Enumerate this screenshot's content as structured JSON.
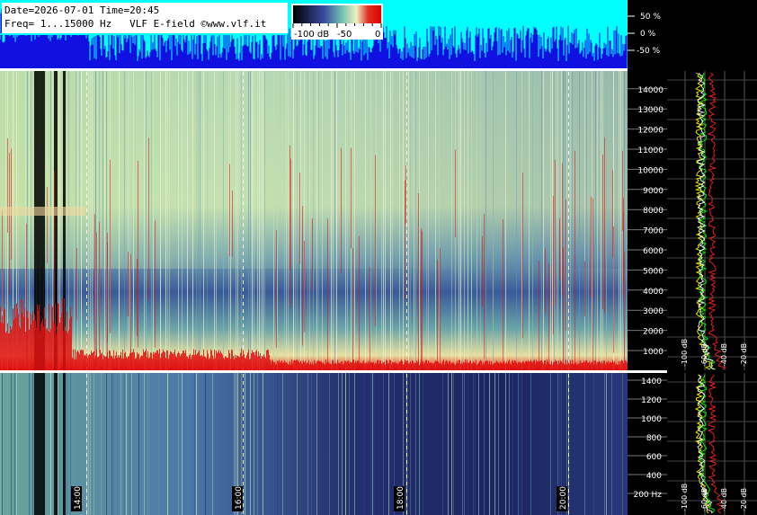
{
  "header": {
    "line1": "Date=2026-07-01 Time=20:45",
    "line2": "Freq= 1...15000 Hz   VLF E-field ©www.vlf.it"
  },
  "colorbar": {
    "labels": [
      "-100 dB",
      "-50",
      "0"
    ],
    "colors": [
      "#000000",
      "#3a4aa0",
      "#6ec0b0",
      "#f0f0c0",
      "#e03020",
      "#e00000"
    ]
  },
  "amplitude_scale": {
    "labels": [
      "50 %",
      "0 %",
      "-50 %"
    ],
    "trace_color": "#1010e0",
    "background": "#00ffff"
  },
  "colors": {
    "background": "#000000",
    "spectro_dark": "#1d2c6e",
    "spectro_mid": "#5a8fa8",
    "spectro_light": "#b8dca8",
    "spectro_hot": "#e01010",
    "spectrum_green": "#00ff00",
    "spectrum_yellow": "#ffff00",
    "spectrum_red": "#ff2020"
  },
  "chart_data": [
    {
      "type": "heatmap",
      "ylabel": "",
      "ylim": [
        0,
        15000
      ],
      "yticks": [
        "1000",
        "2000",
        "3000",
        "4000",
        "5000",
        "6000",
        "7000",
        "8000",
        "9000",
        "10000",
        "11000",
        "12000",
        "13000",
        "14000"
      ],
      "spectrum_xticks": [
        "-100 dB",
        "-60 dB",
        "-40 dB",
        "-20 dB"
      ]
    },
    {
      "type": "heatmap",
      "ylim": [
        0,
        1500
      ],
      "yticks": [
        "200 Hz",
        "400",
        "600",
        "800",
        "1000",
        "1200",
        "1400"
      ],
      "xticks": [
        "14:00",
        "16:00",
        "18:00",
        "20:00"
      ],
      "spectrum_xticks": [
        "-100 dB",
        "-60 dB",
        "-40 dB",
        "-20 dB"
      ]
    }
  ]
}
